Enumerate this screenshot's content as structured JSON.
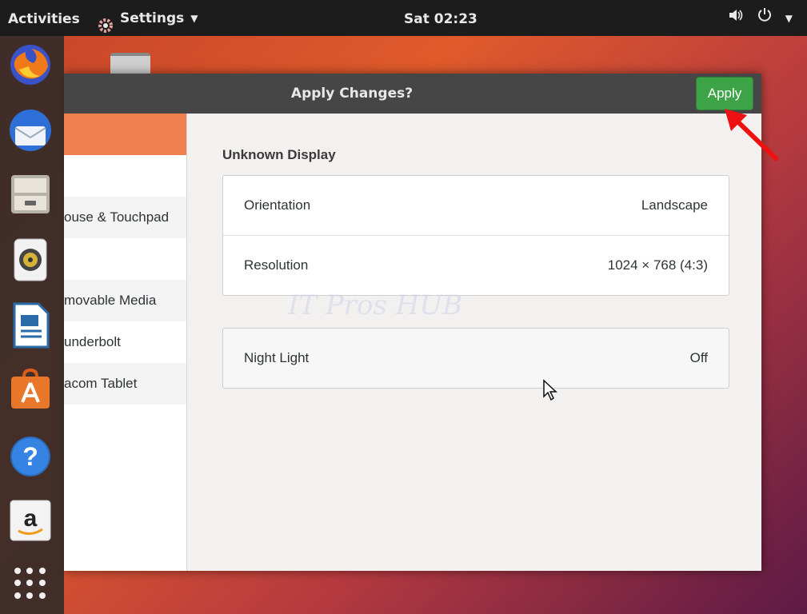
{
  "topbar": {
    "activities": "Activities",
    "app_menu": "Settings",
    "clock": "Sat 02:23"
  },
  "dock": {
    "items": [
      "firefox-icon",
      "thunderbird-icon",
      "files-icon",
      "rhythmbox-icon",
      "libreoffice-writer-icon",
      "software-icon",
      "help-icon",
      "amazon-icon"
    ]
  },
  "window": {
    "title": "Apply Changes?",
    "apply_label": "Apply",
    "sidebar": {
      "items": [
        "",
        "",
        "ouse & Touchpad",
        "",
        "movable Media",
        "underbolt",
        "acom Tablet",
        ""
      ]
    },
    "display_name": "Unknown Display",
    "settings": [
      {
        "label": "Orientation",
        "value": "Landscape"
      },
      {
        "label": "Resolution",
        "value": "1024 × 768 (4:3)"
      }
    ],
    "night_light": {
      "label": "Night Light",
      "value": "Off"
    }
  },
  "watermark": "IT Pros HUB",
  "colors": {
    "apply_button": "#3da347",
    "selected_sidebar": "#f08050",
    "headerbar": "#464646",
    "topbar": "#1c1c1c"
  }
}
